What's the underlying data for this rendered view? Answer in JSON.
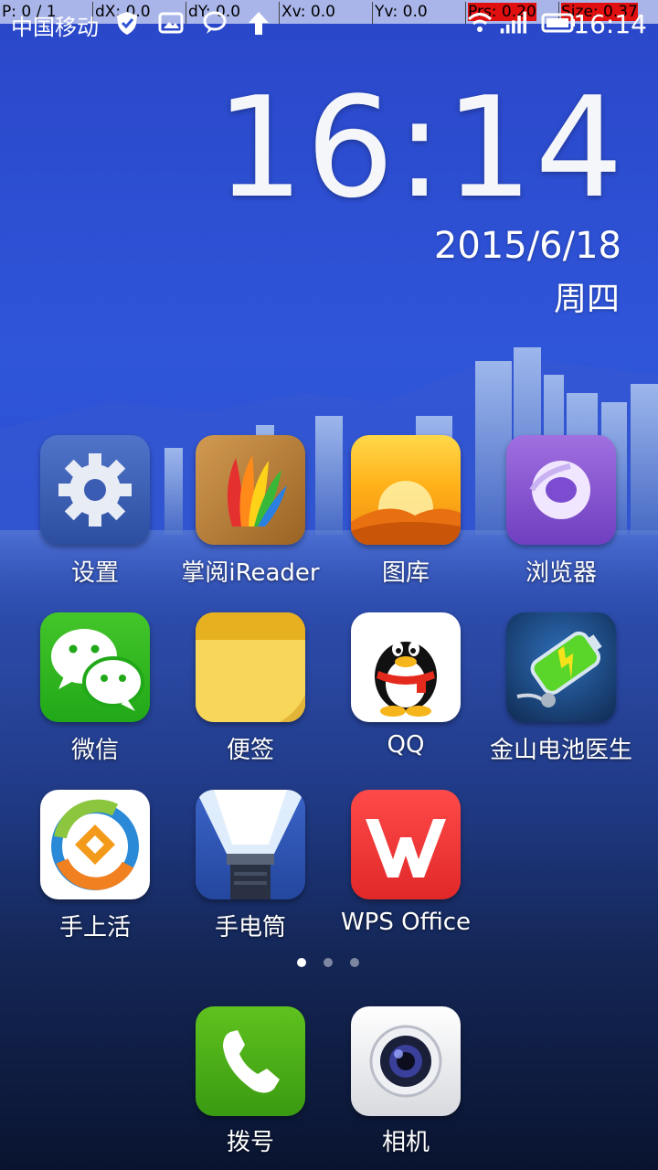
{
  "debug": {
    "p": "P: 0 / 1",
    "dx": "dX: 0.0",
    "dy": "dY: 0.0",
    "xv": "Xv: 0.0",
    "yv": "Yv: 0.0",
    "prs": "Prs: 0.20",
    "size": "Size: 0.37"
  },
  "status_bar": {
    "carrier": "中国移动",
    "time": "16:14",
    "icons": [
      "shield-icon",
      "image-icon",
      "chat-icon",
      "upload-arrow-icon",
      "wifi-icon",
      "signal-icon",
      "battery-icon"
    ]
  },
  "clock": {
    "time": "16:14",
    "date": "2015/6/18",
    "weekday": "周四"
  },
  "apps": [
    {
      "label": "设置",
      "icon": "gear-icon"
    },
    {
      "label": "掌阅iReader",
      "icon": "ireader-icon"
    },
    {
      "label": "图库",
      "icon": "gallery-sunset-icon"
    },
    {
      "label": "浏览器",
      "icon": "browser-icon"
    },
    {
      "label": "微信",
      "icon": "wechat-icon"
    },
    {
      "label": "便签",
      "icon": "notes-icon"
    },
    {
      "label": "QQ",
      "icon": "qq-penguin-icon"
    },
    {
      "label": "金山电池医生",
      "icon": "battery-doctor-icon"
    },
    {
      "label": "手上活",
      "icon": "shoushanghuo-icon"
    },
    {
      "label": "手电筒",
      "icon": "flashlight-icon"
    },
    {
      "label": "WPS Office",
      "icon": "wps-icon"
    }
  ],
  "page_indicator": {
    "pages": 3,
    "current": 1
  },
  "dock": [
    {
      "label": "拨号",
      "icon": "phone-icon"
    },
    {
      "label": "相机",
      "icon": "camera-icon"
    }
  ]
}
